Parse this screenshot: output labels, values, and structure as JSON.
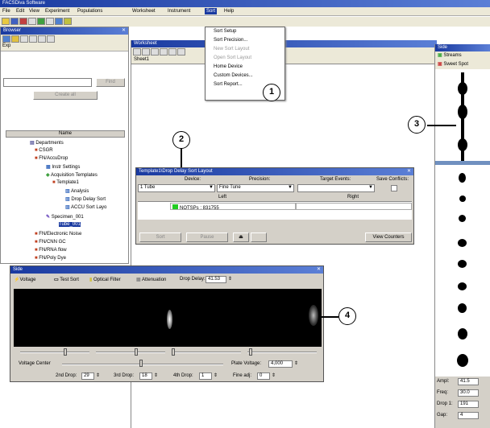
{
  "app": {
    "title": "FACSDiva Software"
  },
  "menubar": {
    "items": [
      "File",
      "Edit",
      "View",
      "Experiment",
      "Populations",
      "Worksheet",
      "Instrument",
      "Sort",
      "Help"
    ]
  },
  "sort_menu": {
    "items": [
      "Sort Setup",
      "Sort Precision...",
      "New Sort Layout",
      "Open Sort Layout",
      "Home Device",
      "Custom Devices...",
      "Sort Report..."
    ]
  },
  "browser": {
    "title": "Browser",
    "tab": "Exp",
    "find": "Find",
    "create_label": "Create all",
    "column_header": "Name",
    "tree": [
      "Departments",
      "CSGR",
      "FN/AccuDrop",
      "Instr Settings",
      "Acquisition Templates",
      "Template1",
      "Analysis",
      "Drop Delay Sort",
      "ACCU Sort Layo",
      "Specimen_001",
      "Tube_001",
      "FN/Electronic Noise",
      "FN/CNN GC",
      "FN/RNA flow",
      "FN/Poly Dye"
    ]
  },
  "worksheet": {
    "title": "Worksheet",
    "tab": "Sheet1"
  },
  "sort_layout": {
    "title": "Template1\\Drop Delay Sort Layout",
    "headers": [
      "Device:",
      "Precision:",
      "Target Events:",
      "Save Conflicts:"
    ],
    "device": "1 Tube",
    "precision": "Fine Tune",
    "col_left": "Left",
    "col_right": "Right",
    "gate": "NOTSPs : 831755",
    "buttons": [
      "Sort",
      "Pause",
      "View Counters"
    ]
  },
  "side_stream": {
    "title": "Side",
    "streams": "Streams",
    "sweet_spot": "Sweet Spot",
    "fields": [
      {
        "label": "Ampl:",
        "value": "41.5"
      },
      {
        "label": "Freq:",
        "value": "30.0"
      },
      {
        "label": "Drop 1:",
        "value": "191"
      },
      {
        "label": "Gap:",
        "value": "4"
      }
    ]
  },
  "stream_panel": {
    "title": "Side",
    "toolbar": [
      "Voltage",
      "Test Sort",
      "Optical Filter",
      "Attenuation",
      "Drop Delay:"
    ],
    "drop_delay": "41.53",
    "voltage_center": "Voltage Center",
    "plate_voltage_label": "Plate Voltage:",
    "plate_voltage": "4,000",
    "drops": [
      {
        "label": "2nd Drop:",
        "value": "29"
      },
      {
        "label": "3rd Drop:",
        "value": "18"
      },
      {
        "label": "4th Drop:",
        "value": "1"
      },
      {
        "label": "Fine adj:",
        "value": "0"
      }
    ]
  },
  "callouts": [
    "1",
    "2",
    "3",
    "4"
  ]
}
